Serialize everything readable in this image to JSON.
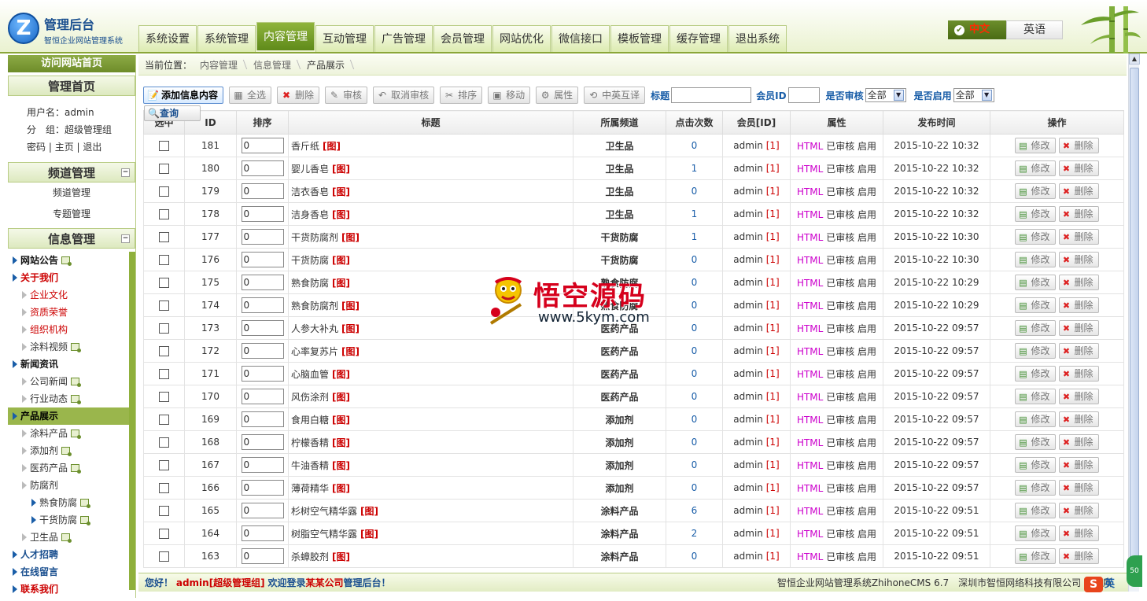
{
  "header": {
    "logo_letter": "Z",
    "title": "管理后台",
    "subtitle": "智恒企业网站管理系统",
    "nav": [
      {
        "label": "系统设置"
      },
      {
        "label": "系统管理"
      },
      {
        "label": "内容管理",
        "active": true
      },
      {
        "label": "互动管理"
      },
      {
        "label": "广告管理"
      },
      {
        "label": "会员管理"
      },
      {
        "label": "网站优化"
      },
      {
        "label": "微信接口"
      },
      {
        "label": "模板管理"
      },
      {
        "label": "缓存管理"
      },
      {
        "label": "退出系统"
      }
    ],
    "lang_cn": "中文",
    "lang_en": "英语"
  },
  "sidebar": {
    "visit": "访问网站首页",
    "home_title": "管理首页",
    "user_label": "用户名：",
    "user_value": "admin",
    "group_label": "分　组：",
    "group_value": "超级管理组",
    "links": [
      "密码",
      "主页",
      "退出"
    ],
    "channel_title": "频道管理",
    "channel_items": [
      "频道管理",
      "专题管理"
    ],
    "info_title": "信息管理",
    "collapse": "−",
    "tree": [
      {
        "label": "网站公告",
        "level": 0,
        "add": true
      },
      {
        "label": "关于我们",
        "level": 0,
        "red": true
      },
      {
        "label": "企业文化",
        "level": 1,
        "red": true
      },
      {
        "label": "资质荣誉",
        "level": 1,
        "red": true
      },
      {
        "label": "组织机构",
        "level": 1,
        "red": true
      },
      {
        "label": "涂料视频",
        "level": 1,
        "add": true
      },
      {
        "label": "新闻资讯",
        "level": 0
      },
      {
        "label": "公司新闻",
        "level": 1,
        "add": true
      },
      {
        "label": "行业动态",
        "level": 1,
        "add": true
      },
      {
        "label": "产品展示",
        "level": 0,
        "active": true
      },
      {
        "label": "涂料产品",
        "level": 1,
        "add": true
      },
      {
        "label": "添加剂",
        "level": 1,
        "add": true
      },
      {
        "label": "医药产品",
        "level": 1,
        "add": true
      },
      {
        "label": "防腐剂",
        "level": 1
      },
      {
        "label": "熟食防腐",
        "level": 2,
        "add": true
      },
      {
        "label": "干货防腐",
        "level": 2,
        "add": true
      },
      {
        "label": "卫生品",
        "level": 1,
        "add": true
      },
      {
        "label": "人才招聘",
        "level": 0,
        "blue": true
      },
      {
        "label": "在线留言",
        "level": 0,
        "blue": true
      },
      {
        "label": "联系我们",
        "level": 0,
        "red": true
      }
    ]
  },
  "crumb": {
    "label": "当前位置：",
    "items": [
      "内容管理",
      "信息管理",
      "产品展示"
    ]
  },
  "toolbar": {
    "buttons": [
      {
        "label": "添加信息内容",
        "icon": "📝",
        "primary": true
      },
      {
        "label": "全选",
        "icon": "▦"
      },
      {
        "label": "删除",
        "icon": "✖"
      },
      {
        "label": "审核",
        "icon": "✎"
      },
      {
        "label": "取消审核",
        "icon": "↶"
      },
      {
        "label": "排序",
        "icon": "✂"
      },
      {
        "label": "移动",
        "icon": "▣"
      },
      {
        "label": "属性",
        "icon": "⚙"
      },
      {
        "label": "中英互译",
        "icon": "⟲"
      }
    ],
    "title_label": "标题",
    "member_label": "会员ID",
    "audit_label": "是否审核",
    "audit_value": "全部",
    "enable_label": "是否启用",
    "enable_value": "全部",
    "search_label": "查询"
  },
  "table": {
    "headers": [
      "选中",
      "ID",
      "排序",
      "标题",
      "所属频道",
      "点击次数",
      "会员[ID]",
      "属性",
      "发布时间",
      "操作"
    ],
    "edit_label": "修改",
    "delete_label": "删除",
    "img_tag": "[图]",
    "attr_html": "HTML",
    "attr_audited": "已审核",
    "attr_enabled": "启用",
    "rows": [
      {
        "id": "181",
        "order": "0",
        "title": "香斤纸",
        "channel": "卫生品",
        "hits": "0",
        "member": "admin",
        "uid": "[1]",
        "time": "2015-10-22 10:32"
      },
      {
        "id": "180",
        "order": "0",
        "title": "婴儿香皂",
        "channel": "卫生品",
        "hits": "1",
        "member": "admin",
        "uid": "[1]",
        "time": "2015-10-22 10:32"
      },
      {
        "id": "179",
        "order": "0",
        "title": "洁衣香皂",
        "channel": "卫生品",
        "hits": "0",
        "member": "admin",
        "uid": "[1]",
        "time": "2015-10-22 10:32"
      },
      {
        "id": "178",
        "order": "0",
        "title": "洁身香皂",
        "channel": "卫生品",
        "hits": "1",
        "member": "admin",
        "uid": "[1]",
        "time": "2015-10-22 10:32"
      },
      {
        "id": "177",
        "order": "0",
        "title": "干货防腐剂",
        "channel": "干货防腐",
        "hits": "1",
        "member": "admin",
        "uid": "[1]",
        "time": "2015-10-22 10:30"
      },
      {
        "id": "176",
        "order": "0",
        "title": "干货防腐",
        "channel": "干货防腐",
        "hits": "0",
        "member": "admin",
        "uid": "[1]",
        "time": "2015-10-22 10:30"
      },
      {
        "id": "175",
        "order": "0",
        "title": "熟食防腐",
        "channel": "熟食防腐",
        "hits": "0",
        "member": "admin",
        "uid": "[1]",
        "time": "2015-10-22 10:29"
      },
      {
        "id": "174",
        "order": "0",
        "title": "熟食防腐剂",
        "channel": "熟食防腐",
        "hits": "0",
        "member": "admin",
        "uid": "[1]",
        "time": "2015-10-22 10:29"
      },
      {
        "id": "173",
        "order": "0",
        "title": "人参大补丸",
        "channel": "医药产品",
        "hits": "0",
        "member": "admin",
        "uid": "[1]",
        "time": "2015-10-22 09:57"
      },
      {
        "id": "172",
        "order": "0",
        "title": "心率复苏片",
        "channel": "医药产品",
        "hits": "0",
        "member": "admin",
        "uid": "[1]",
        "time": "2015-10-22 09:57"
      },
      {
        "id": "171",
        "order": "0",
        "title": "心脑血管",
        "channel": "医药产品",
        "hits": "0",
        "member": "admin",
        "uid": "[1]",
        "time": "2015-10-22 09:57"
      },
      {
        "id": "170",
        "order": "0",
        "title": "风伤涂剂",
        "channel": "医药产品",
        "hits": "0",
        "member": "admin",
        "uid": "[1]",
        "time": "2015-10-22 09:57"
      },
      {
        "id": "169",
        "order": "0",
        "title": "食用白糖",
        "channel": "添加剂",
        "hits": "0",
        "member": "admin",
        "uid": "[1]",
        "time": "2015-10-22 09:57"
      },
      {
        "id": "168",
        "order": "0",
        "title": "柠檬香精",
        "channel": "添加剂",
        "hits": "0",
        "member": "admin",
        "uid": "[1]",
        "time": "2015-10-22 09:57"
      },
      {
        "id": "167",
        "order": "0",
        "title": "牛油香精",
        "channel": "添加剂",
        "hits": "0",
        "member": "admin",
        "uid": "[1]",
        "time": "2015-10-22 09:57"
      },
      {
        "id": "166",
        "order": "0",
        "title": "薄荷精华",
        "channel": "添加剂",
        "hits": "0",
        "member": "admin",
        "uid": "[1]",
        "time": "2015-10-22 09:57"
      },
      {
        "id": "165",
        "order": "0",
        "title": "杉树空气精华露",
        "channel": "涂料产品",
        "hits": "6",
        "member": "admin",
        "uid": "[1]",
        "time": "2015-10-22 09:51"
      },
      {
        "id": "164",
        "order": "0",
        "title": "树脂空气精华露",
        "channel": "涂料产品",
        "hits": "2",
        "member": "admin",
        "uid": "[1]",
        "time": "2015-10-22 09:51"
      },
      {
        "id": "163",
        "order": "0",
        "title": "杀蟑胶剂",
        "channel": "涂料产品",
        "hits": "0",
        "member": "admin",
        "uid": "[1]",
        "time": "2015-10-22 09:51"
      }
    ]
  },
  "footer": {
    "hello": "您好！",
    "admin": "admin[超级管理组]",
    "welcome": "欢迎登录",
    "company": "某某公司",
    "suffix": "管理后台！",
    "right": "智恒企业网站管理系统ZhihoneCMS 6.7　深圳市智恒网络科技有限公司 版权所"
  },
  "watermark": {
    "text": "悟空源码",
    "url": "www.5kym.com"
  },
  "corner": {
    "badge": "S",
    "lang": "英",
    "side": "50"
  },
  "colors": {
    "accent_green": "#8aa638",
    "link_blue": "#1a5ea8",
    "alert_red": "#cc0000",
    "html_magenta": "#cc00cc"
  }
}
